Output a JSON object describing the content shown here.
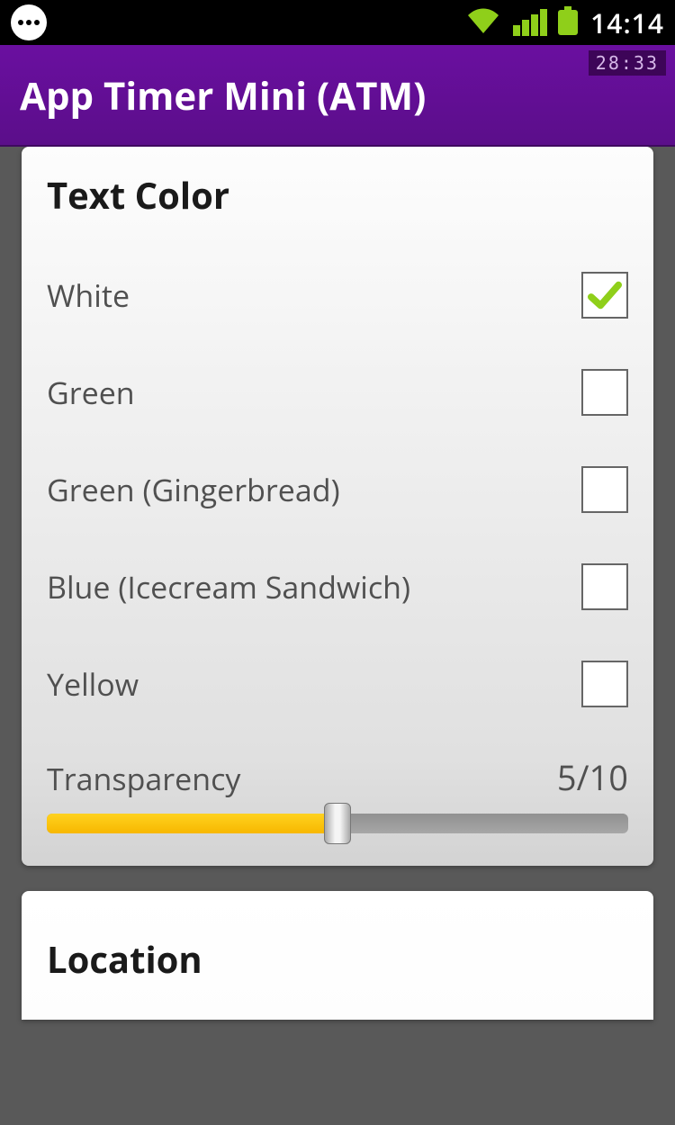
{
  "status": {
    "clock": "14:14"
  },
  "app": {
    "title": "App Timer Mini (ATM)",
    "overlay_timer": "28:33"
  },
  "sections": {
    "text_color": {
      "header": "Text Color",
      "options": [
        {
          "label": "White",
          "checked": true
        },
        {
          "label": "Green",
          "checked": false
        },
        {
          "label": "Green (Gingerbread)",
          "checked": false
        },
        {
          "label": "Blue (Icecream Sandwich)",
          "checked": false
        },
        {
          "label": "Yellow",
          "checked": false
        }
      ],
      "transparency": {
        "label": "Transparency",
        "value_text": "5/10",
        "value": 5,
        "max": 10
      }
    },
    "location": {
      "header": "Location"
    }
  }
}
